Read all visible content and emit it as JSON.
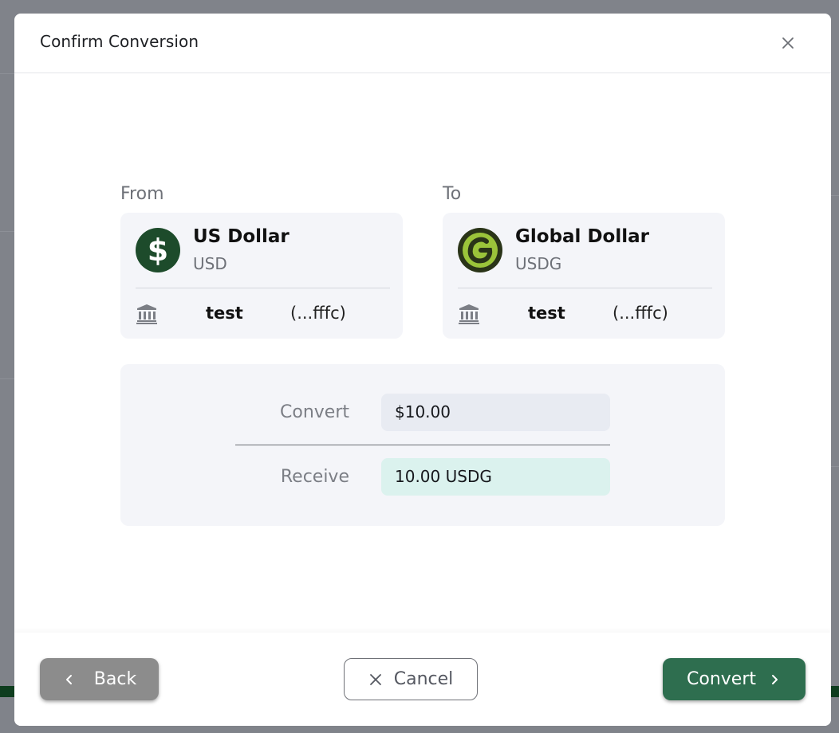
{
  "dialog": {
    "title": "Confirm Conversion"
  },
  "from": {
    "label": "From",
    "currency_name": "US Dollar",
    "currency_code": "USD",
    "icon": "dollar-sign-icon",
    "icon_color": "#1d4b2b",
    "account_name": "test",
    "account_mask": "(...fffc)"
  },
  "to": {
    "label": "To",
    "currency_name": "Global Dollar",
    "currency_code": "USDG",
    "icon": "global-dollar-logo-icon",
    "icon_color": "#9bc43a",
    "account_name": "test",
    "account_mask": "(...fffc)"
  },
  "summary": {
    "convert_label": "Convert",
    "convert_value": "$10.00",
    "receive_label": "Receive",
    "receive_value": "10.00 USDG"
  },
  "footer": {
    "back_label": "Back",
    "cancel_label": "Cancel",
    "convert_label": "Convert"
  },
  "colors": {
    "primary": "#2e6e4f",
    "secondary": "#8c8c8c",
    "receive_highlight": "#dbf2ee"
  }
}
